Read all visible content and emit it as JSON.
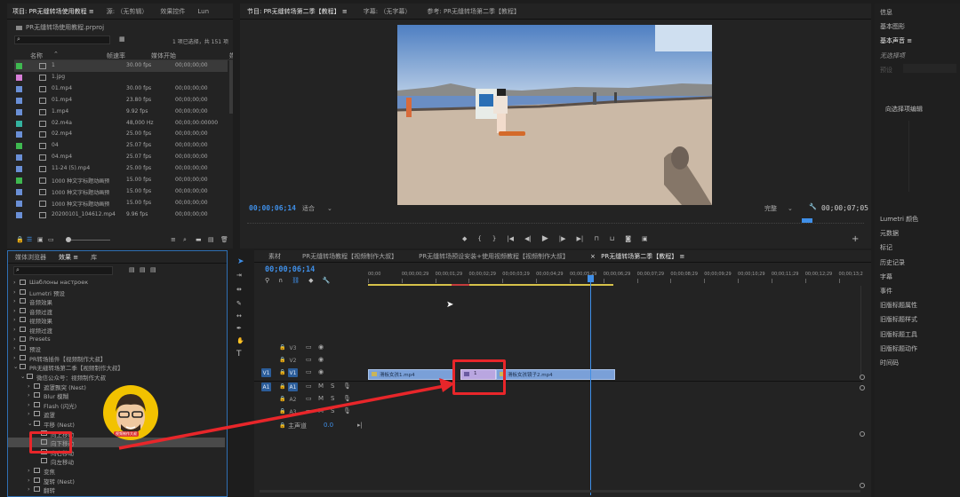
{
  "project_panel": {
    "tabs": [
      "项目: PR无缝转场使用教程 ≡",
      "源: （无剪辑）",
      "效果控件",
      "Lun"
    ],
    "path": "PR无缝转场使用教程.prproj",
    "selection_info": "1 项已选择，共 151 项",
    "columns": [
      "名称",
      "帧速率",
      "媒体开始",
      "媒"
    ],
    "items": [
      {
        "name": "1",
        "fps": "30.00 fps",
        "start": "00;00;00;00",
        "color": "#3fb850"
      },
      {
        "name": "1.jpg",
        "fps": "",
        "start": "",
        "color": "#d77ed7"
      },
      {
        "name": "01.mp4",
        "fps": "30.00 fps",
        "start": "00;00;00;00",
        "color": "#6a8fd6"
      },
      {
        "name": "01.mp4",
        "fps": "23.80 fps",
        "start": "00;00;00;00",
        "color": "#6a8fd6"
      },
      {
        "name": "1.mp4",
        "fps": "9.92 fps",
        "start": "00;00;00;00",
        "color": "#6a8fd6"
      },
      {
        "name": "02.m4a",
        "fps": "48,000 Hz",
        "start": "00;00;00:00000",
        "color": "#34b3a0"
      },
      {
        "name": "02.mp4",
        "fps": "25.00 fps",
        "start": "00;00;00;00",
        "color": "#6a8fd6"
      },
      {
        "name": "04",
        "fps": "25.07 fps",
        "start": "00;00;00;00",
        "color": "#3fb850"
      },
      {
        "name": "04.mp4",
        "fps": "25.07 fps",
        "start": "00;00;00;00",
        "color": "#6a8fd6"
      },
      {
        "name": "11-24 (5).mp4",
        "fps": "25.00 fps",
        "start": "00;00;00;00",
        "color": "#6a8fd6"
      },
      {
        "name": "1000 种文字标题动画预",
        "fps": "15.00 fps",
        "start": "00;00;00;00",
        "color": "#3fb850"
      },
      {
        "name": "1000 种文字标题动画预",
        "fps": "15.00 fps",
        "start": "00;00;00;00",
        "color": "#6a8fd6"
      },
      {
        "name": "1000 种文字标题动画预",
        "fps": "15.00 fps",
        "start": "00;00;00;00",
        "color": "#6a8fd6"
      },
      {
        "name": "20200101_104612.mp4",
        "fps": "9.96 fps",
        "start": "00;00;00;00",
        "color": "#6a8fd6"
      }
    ]
  },
  "effects_panel": {
    "tabs": [
      "媒体浏览器",
      "效果 ≡",
      "库"
    ],
    "tree": [
      {
        "label": "Шаблоны настроек",
        "indent": 0,
        "twisty": "›",
        "folder": true
      },
      {
        "label": "Lumetri 预设",
        "indent": 0,
        "twisty": "›",
        "folder": true
      },
      {
        "label": "音频效果",
        "indent": 0,
        "twisty": "›",
        "folder": true
      },
      {
        "label": "音频过渡",
        "indent": 0,
        "twisty": "›",
        "folder": true
      },
      {
        "label": "视频效果",
        "indent": 0,
        "twisty": "›",
        "folder": true
      },
      {
        "label": "视频过渡",
        "indent": 0,
        "twisty": "›",
        "folder": true
      },
      {
        "label": "Presets",
        "indent": 0,
        "twisty": "›",
        "folder": true
      },
      {
        "label": "预设",
        "indent": 0,
        "twisty": "›",
        "folder": true
      },
      {
        "label": "PR转场插件【视频制作大叔】",
        "indent": 0,
        "twisty": "›",
        "folder": true
      },
      {
        "label": "PR无缝转场第二季【视频制作大叔】",
        "indent": 0,
        "twisty": "⌄",
        "folder": true
      },
      {
        "label": "微信公众号：视频制作大叔",
        "indent": 1,
        "twisty": "⌄",
        "folder": true
      },
      {
        "label": "遮罩飘突 (Nest)",
        "indent": 2,
        "twisty": "›",
        "folder": true
      },
      {
        "label": "Blur 模糊",
        "indent": 2,
        "twisty": "›",
        "folder": true
      },
      {
        "label": "Flash (闪光)",
        "indent": 2,
        "twisty": "›",
        "folder": true
      },
      {
        "label": "遮罩",
        "indent": 2,
        "twisty": "›",
        "folder": true
      },
      {
        "label": "平移 (Nest)",
        "indent": 2,
        "twisty": "⌄",
        "folder": true
      },
      {
        "label": "向上移动",
        "indent": 3,
        "twisty": "",
        "folder": false
      },
      {
        "label": "向下移动",
        "indent": 3,
        "twisty": "",
        "folder": false,
        "selected": true
      },
      {
        "label": "向右移动",
        "indent": 3,
        "twisty": "",
        "folder": false
      },
      {
        "label": "向左移动",
        "indent": 3,
        "twisty": "",
        "folder": false
      },
      {
        "label": "变焦",
        "indent": 2,
        "twisty": "›",
        "folder": true
      },
      {
        "label": "旋转 (Nest)",
        "indent": 2,
        "twisty": "›",
        "folder": true
      },
      {
        "label": "翻转",
        "indent": 2,
        "twisty": "›",
        "folder": true
      }
    ],
    "watermark": "视频制作大叔"
  },
  "program_monitor": {
    "tabs": [
      "节目: PR无缝转场第二季【教程】 ≡",
      "字幕: （无字幕）",
      "参考: PR无缝转场第二季【教程】"
    ],
    "timecode_current": "00;00;06;14",
    "fit": "适合",
    "quality": "完整",
    "timecode_end": "00;00;07;05"
  },
  "timeline": {
    "tabs": [
      "素材",
      "PR无缝转场教程【视频制作大叔】",
      "PR无缝转场预设安装+使用视频教程【视频制作大叔】",
      "PR无缝转场第二季【教程】 ≡"
    ],
    "close_mark": "×",
    "timecode": "00;00;06;14",
    "ruler": [
      "00;00",
      "00;00;00;29",
      "00;00;01;29",
      "00;00;02;29",
      "00;00;03;29",
      "00;00;04;29",
      "00;00;05;29",
      "00;00;06;29",
      "00;00;07;29",
      "00;00;08;29",
      "00;00;09;29",
      "00;00;10;29",
      "00;00;11;29",
      "00;00;12;29",
      "00;00;13;2"
    ],
    "tracks": [
      {
        "id": "V3",
        "type": "video"
      },
      {
        "id": "V2",
        "type": "video"
      },
      {
        "id": "V1",
        "type": "video",
        "src": "V1"
      },
      {
        "id": "A1",
        "type": "audio",
        "src": "A1"
      },
      {
        "id": "A2",
        "type": "audio"
      },
      {
        "id": "A3",
        "type": "audio"
      }
    ],
    "master": {
      "label": "主声道",
      "value": "0.0"
    },
    "clips": [
      {
        "name": "滑板女孩1.mp4",
        "track": "V1"
      },
      {
        "name": "1",
        "track": "V1",
        "adjustment": true
      },
      {
        "name": "滑板女孩镜子2.mp4",
        "track": "V1"
      }
    ]
  },
  "right_panel": {
    "items_top": [
      "信息",
      "基本图形",
      "基本声音 ≡"
    ],
    "no_selection": "无选择项",
    "label_dim": "预设",
    "select_hint": "向选择项编辑",
    "items_bottom": [
      "Lumetri 颜色",
      "元数据",
      "标记",
      "历史记录",
      "字幕",
      "事件",
      "旧版标题属性",
      "旧版标题样式",
      "旧版标题工具",
      "旧版标题动作",
      "时间码"
    ]
  },
  "colors": {
    "accent_blue": "#3f8fe8",
    "annotation_red": "#e8262a",
    "clip_blue": "#7aa0d8",
    "adjustment_clip": "#b9a6e0"
  }
}
